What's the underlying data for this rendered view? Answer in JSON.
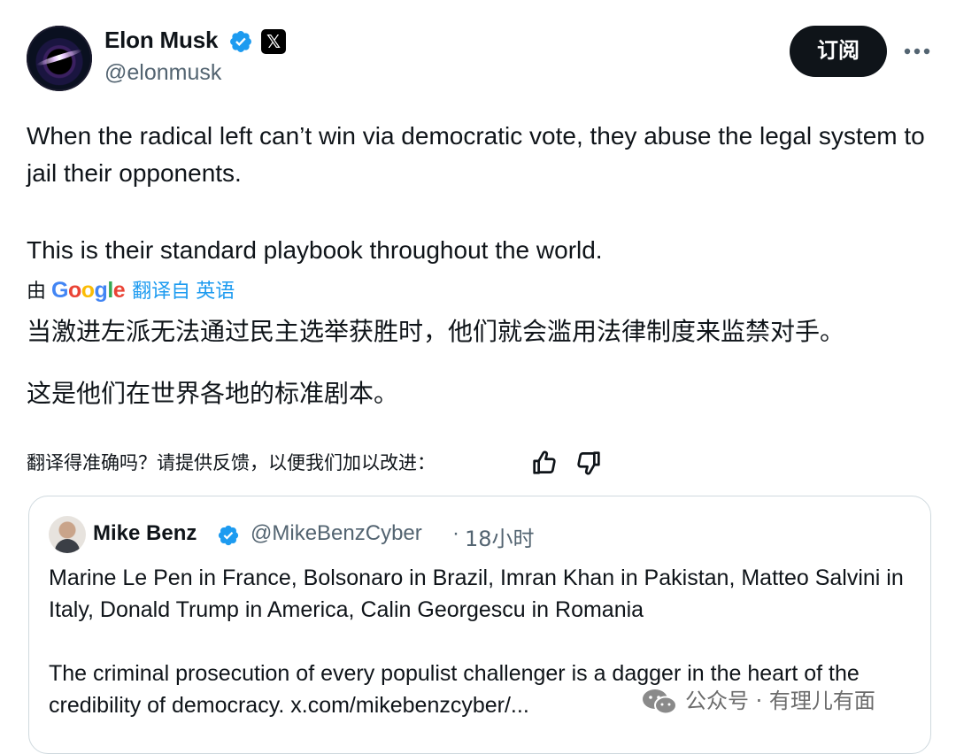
{
  "author": {
    "name": "Elon Musk",
    "handle": "@elonmusk",
    "x_badge": "𝕏"
  },
  "header": {
    "subscribe_label": "订阅"
  },
  "tweet": {
    "text_p1": "When the radical left can’t win via democratic vote, they abuse the legal system to jail their opponents.",
    "text_p2": "This is their standard playbook throughout the world."
  },
  "translation": {
    "by_label": "由",
    "google_letters": [
      "G",
      "o",
      "o",
      "g",
      "l",
      "e"
    ],
    "google_colors": [
      "#4285F4",
      "#EA4335",
      "#FBBC05",
      "#4285F4",
      "#34A853",
      "#EA4335"
    ],
    "translated_from": "翻译自 英语",
    "text_p1": "当激进左派无法通过民主选举获胜时，他们就会滥用法律制度来监禁对手。",
    "text_p2": "这是他们在世界各地的标准剧本。",
    "feedback_prompt": "翻译得准确吗？请提供反馈，以便我们加以改进："
  },
  "quoted": {
    "name": "Mike Benz",
    "handle": "@MikeBenzCyber",
    "separator": "·",
    "time": "18小时",
    "text_p1": "Marine Le Pen in France, Bolsonaro in Brazil, Imran Khan in Pakistan, Matteo Salvini in Italy, Donald Trump in America, Calin Georgescu in Romania",
    "text_p2": "The criminal prosecution of every populist challenger is a dagger in the heart of the credibility of democracy. x.com/mikebenzcyber/..."
  },
  "watermark": {
    "text": "公众号 · 有理儿有面"
  },
  "colors": {
    "text": "#0f1419",
    "secondary": "#536471",
    "link": "#1d9bf0",
    "verified": "#1d9bf0",
    "border": "#cfd9de",
    "button_bg": "#0f1419"
  },
  "icons": {
    "more": "more-horizontal-icon",
    "verified": "verified-badge-icon",
    "thumbs_up": "thumbs-up-icon",
    "thumbs_down": "thumbs-down-icon",
    "wechat": "wechat-icon"
  }
}
